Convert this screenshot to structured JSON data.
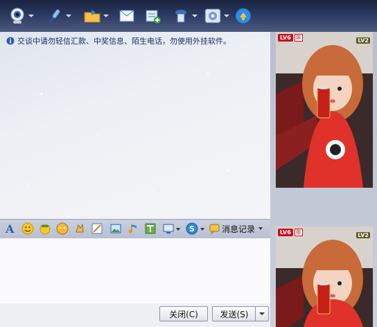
{
  "toolbar": {
    "buttons": [
      {
        "icon": "video-call-icon"
      },
      {
        "icon": "voice-call-icon"
      },
      {
        "icon": "send-file-icon"
      },
      {
        "icon": "send-sms-icon"
      },
      {
        "icon": "create-group-icon"
      },
      {
        "icon": "remote-assist-icon"
      },
      {
        "icon": "apps-icon"
      },
      {
        "icon": "share-icon"
      }
    ]
  },
  "chat": {
    "notice": "交谈中请勿轻信汇款、中奖信息、陌生电话，勿使用外挂软件。"
  },
  "format_bar": {
    "icons": [
      "font-icon",
      "emoticon-icon",
      "magic-expression-icon",
      "emoji-icon",
      "shake-icon",
      "screenshot-icon",
      "image-icon",
      "music-icon",
      "scrawl-icon",
      "screen-share-icon",
      "soso-search-icon"
    ],
    "history_label": "消息记录"
  },
  "input": {
    "value": ""
  },
  "buttons": {
    "close_label": "关闭(C)",
    "send_label": "发送(S)"
  },
  "avatars": [
    {
      "level": "LV6",
      "year": "年",
      "badge": "LV2"
    },
    {
      "level": "LV6",
      "year": "年",
      "badge": "LV2"
    }
  ],
  "colors": {
    "accent": "#1a2a6a",
    "badge_red": "#c4121f"
  }
}
